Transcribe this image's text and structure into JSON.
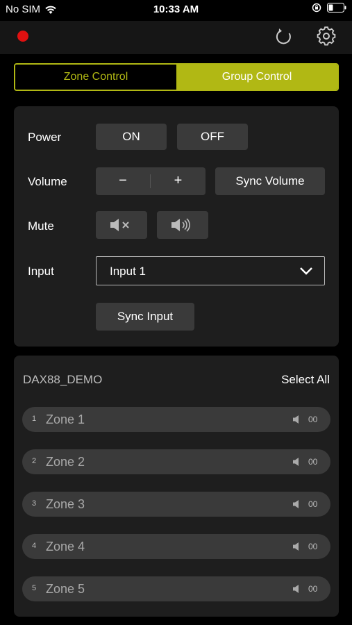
{
  "status_bar": {
    "carrier": "No SIM",
    "time": "10:33 AM"
  },
  "tabs": {
    "zone_control": "Zone Control",
    "group_control": "Group Control"
  },
  "controls": {
    "power_label": "Power",
    "power_on": "ON",
    "power_off": "OFF",
    "volume_label": "Volume",
    "volume_minus": "−",
    "volume_plus": "+",
    "sync_volume": "Sync Volume",
    "mute_label": "Mute",
    "input_label": "Input",
    "input_selected": "Input 1",
    "sync_input": "Sync Input"
  },
  "zones_panel": {
    "title": "DAX88_DEMO",
    "select_all": "Select All",
    "zones": [
      {
        "num": "1",
        "name": "Zone 1",
        "volume": "00"
      },
      {
        "num": "2",
        "name": "Zone 2",
        "volume": "00"
      },
      {
        "num": "3",
        "name": "Zone 3",
        "volume": "00"
      },
      {
        "num": "4",
        "name": "Zone 4",
        "volume": "00"
      },
      {
        "num": "5",
        "name": "Zone 5",
        "volume": "00"
      }
    ]
  },
  "colors": {
    "accent": "#b1b814",
    "record": "#e01010",
    "panel": "#1e1e1e",
    "button": "#3a3a3a"
  },
  "icons": [
    "wifi-icon",
    "orientation-lock-icon",
    "battery-icon",
    "record-indicator",
    "refresh-icon",
    "gear-icon",
    "mute-icon",
    "speaker-icon",
    "chevron-down-icon",
    "zone-speaker-icon"
  ]
}
